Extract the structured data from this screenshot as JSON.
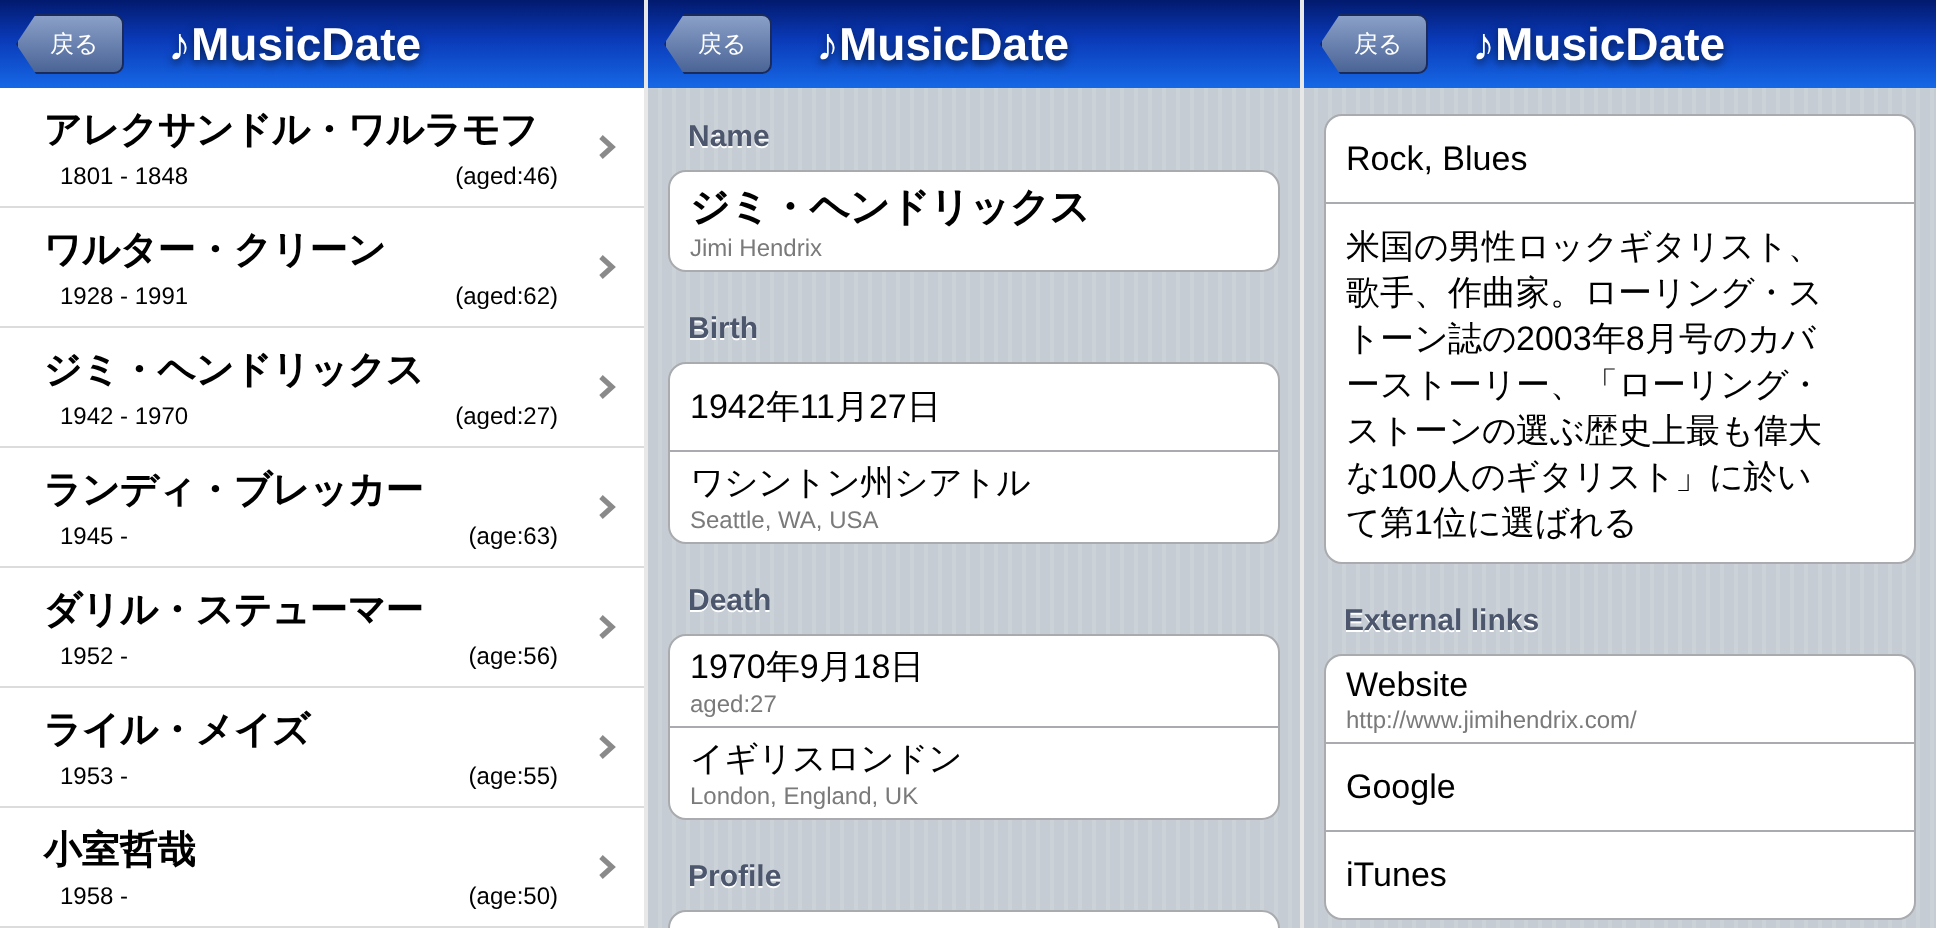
{
  "screens": [
    {
      "kind": "list",
      "back": "戻る",
      "title": "♪MusicDate",
      "rows": [
        {
          "name": "アレクサンドル・ワルラモフ",
          "years": "1801 - 1848",
          "age": "(aged:46)"
        },
        {
          "name": "ワルター・クリーン",
          "years": "1928 - 1991",
          "age": "(aged:62)"
        },
        {
          "name": "ジミ・ヘンドリックス",
          "years": "1942 - 1970",
          "age": "(aged:27)"
        },
        {
          "name": "ランディ・ブレッカー",
          "years": "1945 -",
          "age": "(age:63)"
        },
        {
          "name": "ダリル・ステューマー",
          "years": "1952 -",
          "age": "(age:56)"
        },
        {
          "name": "ライル・メイズ",
          "years": "1953 -",
          "age": "(age:55)"
        },
        {
          "name": "小室哲哉",
          "years": "1958 -",
          "age": "(age:50)"
        }
      ]
    },
    {
      "kind": "detail",
      "back": "戻る",
      "title": "♪MusicDate",
      "sections": [
        {
          "header": "Name",
          "cells": [
            {
              "kind": "name",
              "primary": "ジミ・ヘンドリックス",
              "secondary": "Jimi Hendrix"
            }
          ]
        },
        {
          "header": "Birth",
          "cells": [
            {
              "kind": "value",
              "primary": "1942年11月27日"
            },
            {
              "kind": "value",
              "primary": "ワシントン州シアトル",
              "secondary": "Seattle, WA, USA"
            }
          ]
        },
        {
          "header": "Death",
          "cells": [
            {
              "kind": "value",
              "primary": "1970年9月18日",
              "secondary": "aged:27"
            },
            {
              "kind": "value",
              "primary": "イギリスロンドン",
              "secondary": "London, England, UK"
            }
          ]
        },
        {
          "header": "Profile",
          "continued": true
        }
      ]
    },
    {
      "kind": "detail",
      "back": "戻る",
      "title": "♪MusicDate",
      "sections": [
        {
          "cells": [
            {
              "kind": "value",
              "primary": "Rock, Blues"
            },
            {
              "kind": "text",
              "primary": "米国の男性ロックギタリスト、歌手、作曲家。ローリング・ストーン誌の2003年8月号のカバーストーリー、「ローリング・ストーンの選ぶ歴史上最も偉大な100人のギタリスト」に於いて第1位に選ばれる"
            }
          ]
        },
        {
          "header": "External links",
          "cells": [
            {
              "kind": "link",
              "primary": "Website",
              "secondary": "http://www.jimihendrix.com/"
            },
            {
              "kind": "link",
              "primary": "Google"
            },
            {
              "kind": "link",
              "primary": "iTunes"
            }
          ]
        }
      ]
    }
  ]
}
